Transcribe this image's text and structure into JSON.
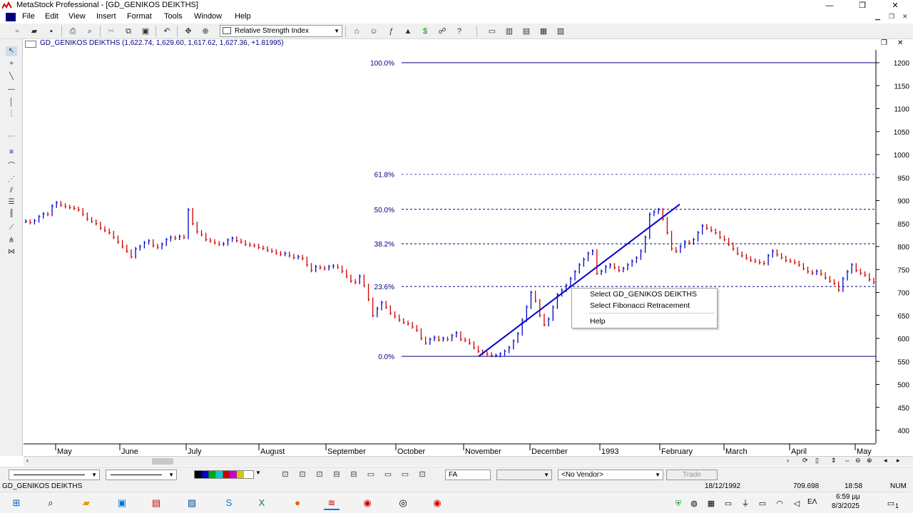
{
  "window": {
    "title": "MetaStock Professional - [GD_GENIKOS DEIKTHS]",
    "controls": [
      "—",
      "❐",
      "✕"
    ]
  },
  "menu": [
    "File",
    "Edit",
    "View",
    "Insert",
    "Format",
    "Tools",
    "Window",
    "Help"
  ],
  "toolbar": {
    "indicator_select": "Relative Strength Index"
  },
  "chart": {
    "title": "GD_GENIKOS DEIKTHS",
    "ohlc": "(1,622.74, 1,629.60, 1,617.62, 1,627.36, +1.81995)"
  },
  "chart_data": {
    "type": "line",
    "y_ticks": [
      1200,
      1150,
      1100,
      1050,
      1000,
      950,
      900,
      850,
      800,
      750,
      700,
      650,
      600,
      550,
      500,
      450,
      400
    ],
    "ylim": [
      385,
      1215
    ],
    "x_months": [
      "May",
      "June",
      "July",
      "August",
      "September",
      "October",
      "November",
      "December",
      "1993",
      "February",
      "March",
      "April",
      "May"
    ],
    "fibonacci_levels": [
      {
        "label": "100.0%",
        "value": 1200
      },
      {
        "label": "61.8%",
        "value": 957
      },
      {
        "label": "50.0%",
        "value": 881
      },
      {
        "label": "38.2%",
        "value": 806
      },
      {
        "label": "23.6%",
        "value": 713
      },
      {
        "label": "0.0%",
        "value": 561
      }
    ],
    "price_series": [
      855,
      852,
      856,
      865,
      871,
      870,
      888,
      895,
      890,
      887,
      885,
      883,
      880,
      870,
      860,
      855,
      850,
      840,
      835,
      830,
      820,
      810,
      800,
      790,
      778,
      795,
      800,
      808,
      812,
      802,
      798,
      805,
      815,
      820,
      818,
      822,
      820,
      880,
      850,
      832,
      826,
      815,
      812,
      808,
      805,
      806,
      814,
      818,
      813,
      810,
      805,
      803,
      802,
      798,
      796,
      792,
      790,
      786,
      783,
      785,
      780,
      776,
      778,
      774,
      760,
      748,
      756,
      754,
      752,
      756,
      758,
      755,
      746,
      735,
      725,
      722,
      735,
      715,
      685,
      650,
      665,
      678,
      668,
      655,
      648,
      640,
      635,
      632,
      625,
      618,
      600,
      590,
      598,
      602,
      597,
      600,
      598,
      606,
      612,
      598,
      596,
      590,
      580,
      572,
      568,
      566,
      563,
      563,
      566,
      572,
      580,
      594,
      610,
      640,
      668,
      700,
      682,
      650,
      630,
      642,
      668,
      695,
      705,
      715,
      730,
      745,
      760,
      772,
      785,
      790,
      742,
      746,
      756,
      760,
      754,
      748,
      752,
      760,
      768,
      775,
      790,
      820,
      870,
      875,
      880,
      860,
      830,
      795,
      790,
      800,
      810,
      808,
      815,
      830,
      845,
      840,
      835,
      830,
      820,
      815,
      805,
      795,
      785,
      780,
      775,
      770,
      768,
      765,
      763,
      780,
      790,
      782,
      776,
      770,
      768,
      765,
      760,
      752,
      745,
      742,
      746,
      740,
      732,
      725,
      720,
      705,
      730,
      745,
      760,
      748,
      742,
      738,
      728,
      722
    ]
  },
  "fib_trendline": {
    "start_value": 561,
    "end_value": 892
  },
  "context_menu": {
    "items": [
      "Select GD_GENIKOS DEIKTHS",
      "Select Fibonacci Retracement",
      "Help"
    ]
  },
  "bottom_tools": {
    "vendor_select": "<No Vendor>",
    "symbol_field": "FA",
    "trade_button": "Trade"
  },
  "status": {
    "security": "GD_GENIKOS DEIKTHS",
    "date": "18/12/1992",
    "value": "709.698",
    "time": "18:58",
    "num": "NUM"
  },
  "taskbar": {
    "time": "6:59 μμ",
    "date": "8/3/2025",
    "lang": "ΕΛ",
    "notif_count": "1"
  },
  "colors": {
    "up_bar": "#0000cc",
    "down_bar": "#cc0000",
    "fib_line": "#000080",
    "trendline": "#0000cc"
  }
}
